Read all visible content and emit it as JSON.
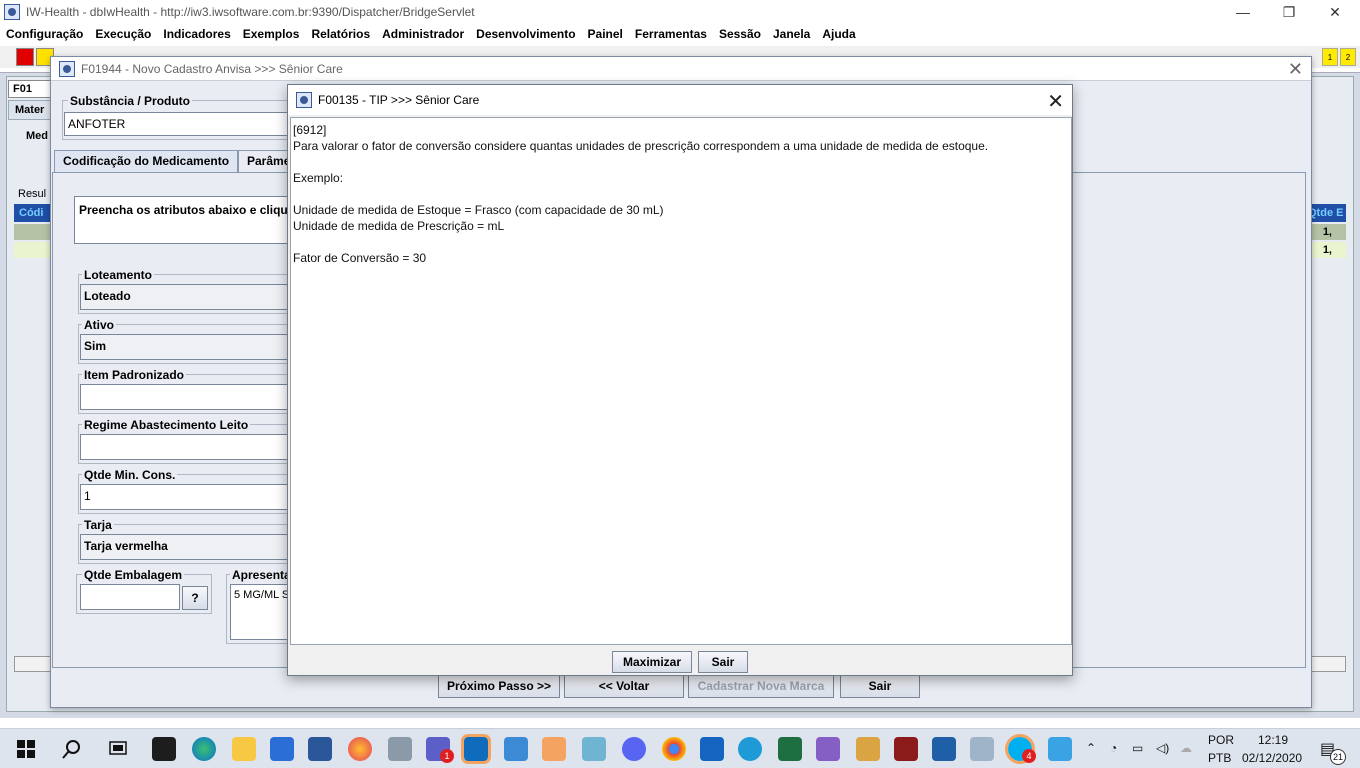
{
  "browser": {
    "title": "IW-Health - dbIwHealth - http://iw3.iwsoftware.com.br:9390/Dispatcher/BridgeServlet",
    "minimize": "—",
    "restore": "❐",
    "close": "✕"
  },
  "menu": [
    "Configuração",
    "Execução",
    "Indicadores",
    "Exemplos",
    "Relatórios",
    "Administrador",
    "Desenvolvimento",
    "Painel",
    "Ferramentas",
    "Sessão",
    "Janela",
    "Ajuda"
  ],
  "toolbar": {
    "badges": [
      "1",
      "2"
    ]
  },
  "background": {
    "tab_label": "F01",
    "side_tab": "Mater",
    "side_tab2": "Med",
    "result_label": "Resul",
    "col_left": "Códi",
    "col_right": "Qtde E",
    "row_values": [
      "1,",
      "1,"
    ]
  },
  "cadastro": {
    "title": "F01944 - Novo Cadastro Anvisa >>> Sênior Care",
    "close": "✕",
    "substancia_label": "Substância / Produto",
    "substancia_value": "ANFOTER",
    "tabs": [
      "Codificação do Medicamento",
      "Parâme"
    ],
    "instruction": "Preencha os atributos abaixo e cliqu",
    "fields": [
      {
        "label": "Loteamento",
        "value": "Loteado"
      },
      {
        "label": "Ativo",
        "value": "Sim"
      },
      {
        "label": "Item Padronizado",
        "value": ""
      },
      {
        "label": "Regime Abastecimento Leito",
        "value": ""
      },
      {
        "label": "Qtde Min. Cons.",
        "value": "1"
      },
      {
        "label": "Tarja",
        "value": "Tarja vermelha"
      }
    ],
    "qtde_embalagem_label": "Qtde Embalagem",
    "qtde_embalagem_value": "",
    "help_button": "?",
    "apresentacao_label": "Apresenta",
    "apresentacao_value": "5 MG/ML S",
    "buttons": {
      "next": "Próximo Passo >>",
      "back": "<< Voltar",
      "new_brand": "Cadastrar Nova Marca",
      "exit": "Sair"
    }
  },
  "tip": {
    "title": "F00135 - TIP >>> Sênior Care",
    "close": "✕",
    "lines": [
      "[6912]",
      "Para valorar o fator de conversão considere quantas unidades de prescrição correspondem a uma unidade de medida de estoque.",
      "",
      "Exemplo:",
      "",
      "Unidade de medida de Estoque = Frasco (com capacidade de 30 mL)",
      "Unidade de medida de Prescrição = mL",
      "",
      "Fator de Conversão = 30"
    ],
    "buttons": {
      "maximize": "Maximizar",
      "exit": "Sair"
    }
  },
  "taskbar": {
    "lang_top": "POR",
    "lang_bottom": "PTB",
    "time": "12:19",
    "date": "02/12/2020",
    "notifications": "21",
    "teams_badge": "1",
    "skype_badge": "4",
    "icons": [
      "windows-start-icon",
      "search-icon",
      "task-view-icon",
      "store-icon",
      "edge-icon",
      "file-explorer-icon",
      "mail-icon",
      "word-icon",
      "firefox-icon",
      "tool-icon",
      "teams-icon",
      "outlook-icon",
      "remote-desktop-icon",
      "java-icon",
      "notepad-icon",
      "discord-icon",
      "chrome-icon",
      "photos-icon",
      "internet-explorer-icon",
      "excel-icon",
      "visual-studio-icon",
      "paint-icon",
      "winrar-icon",
      "virtualbox-icon",
      "monitor-icon",
      "skype-icon",
      "azure-icon"
    ]
  }
}
